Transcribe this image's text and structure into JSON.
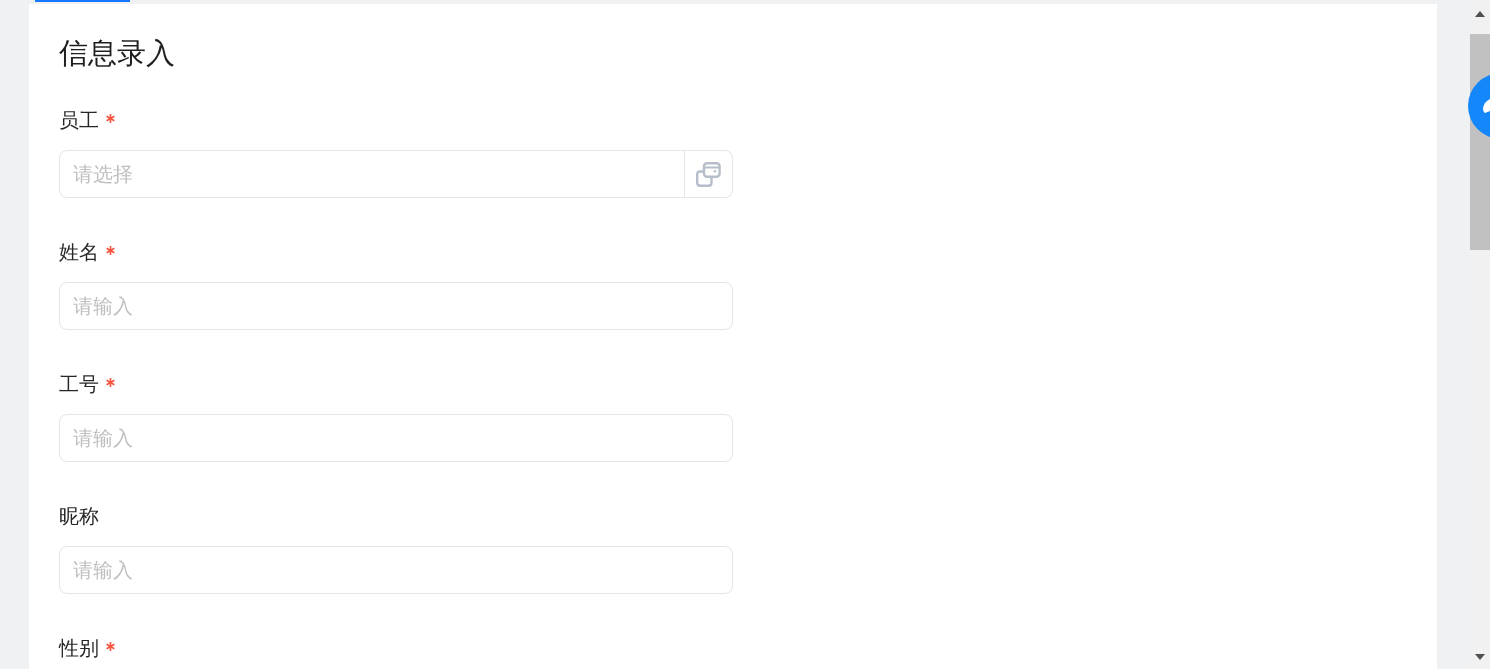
{
  "title": "信息录入",
  "fields": [
    {
      "label": "员工",
      "required": true,
      "kind": "select",
      "placeholder": "请选择"
    },
    {
      "label": "姓名",
      "required": true,
      "kind": "text",
      "placeholder": "请输入"
    },
    {
      "label": "工号",
      "required": true,
      "kind": "text",
      "placeholder": "请输入"
    },
    {
      "label": "昵称",
      "required": false,
      "kind": "text",
      "placeholder": "请输入"
    },
    {
      "label": "性别",
      "required": true
    }
  ]
}
